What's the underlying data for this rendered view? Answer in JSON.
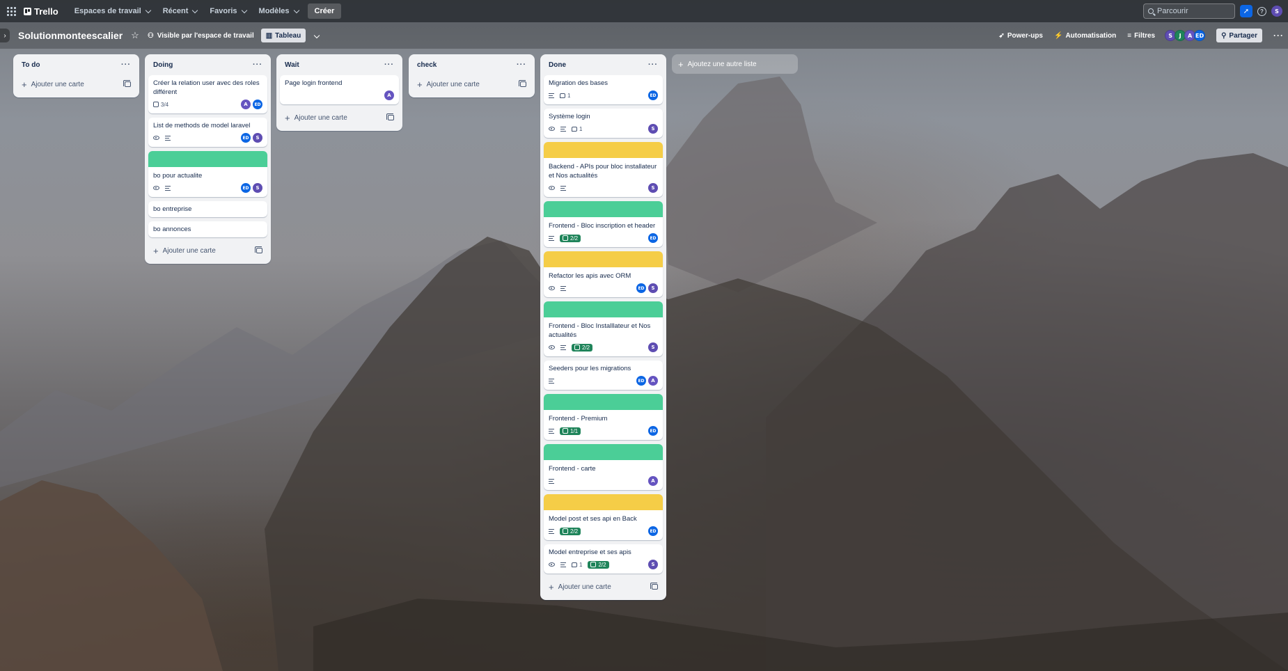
{
  "topnav": {
    "logo": "Trello",
    "menus": [
      {
        "label": "Espaces de travail"
      },
      {
        "label": "Récent"
      },
      {
        "label": "Favoris"
      },
      {
        "label": "Modèles"
      }
    ],
    "create_label": "Créer",
    "search_placeholder": "Parcourir",
    "user_initial": "S"
  },
  "board_header": {
    "title": "Solutionmonteescalier",
    "visibility": "Visible par l'espace de travail",
    "view": "Tableau",
    "powerups": "Power-ups",
    "automation": "Automatisation",
    "filters": "Filtres",
    "members": [
      "S",
      "J",
      "A",
      "ED"
    ],
    "share": "Partager"
  },
  "lists": [
    {
      "title": "To do",
      "add_label": "Ajouter une carte",
      "cards": []
    },
    {
      "title": "Doing",
      "add_label": "Ajouter une carte",
      "cards": [
        {
          "title": "Créer la relation user avec des roles différent",
          "checklist": "3/4",
          "members": [
            "A",
            "ED"
          ]
        },
        {
          "title": "List de methods de model laravel",
          "watch": true,
          "desc": true,
          "members": [
            "ED",
            "S"
          ]
        },
        {
          "title": "bo pour actualite",
          "cover": "green",
          "watch": true,
          "desc": true,
          "members": [
            "ED",
            "S"
          ]
        },
        {
          "title": "bo entreprise"
        },
        {
          "title": "bo annonces"
        }
      ]
    },
    {
      "title": "Wait",
      "add_label": "Ajouter une carte",
      "cards": [
        {
          "title": "Page login frontend",
          "members": [
            "A"
          ]
        }
      ]
    },
    {
      "title": "check",
      "add_label": "Ajouter une carte",
      "cards": []
    },
    {
      "title": "Done",
      "add_label": "Ajouter une carte",
      "cards": [
        {
          "title": "Migration des bases",
          "desc": true,
          "comments": "1",
          "members": [
            "ED"
          ]
        },
        {
          "title": "Système login",
          "watch": true,
          "desc": true,
          "comments": "1",
          "members": [
            "S"
          ]
        },
        {
          "title": "Backend - APIs pour bloc installateur et Nos actualités",
          "cover": "yellow",
          "watch": true,
          "desc": true,
          "members": [
            "S"
          ]
        },
        {
          "title": "Frontend - Bloc inscription et header",
          "cover": "green",
          "desc": true,
          "checklist": "2/2",
          "checklist_done": true,
          "members": [
            "ED"
          ]
        },
        {
          "title": "Refactor les apis avec ORM",
          "cover": "yellow",
          "watch": true,
          "desc": true,
          "members": [
            "ED",
            "S"
          ]
        },
        {
          "title": "Frontend - Bloc Installlateur et Nos actualités",
          "cover": "green",
          "watch": true,
          "desc": true,
          "checklist": "2/2",
          "checklist_done": true,
          "members": [
            "S"
          ]
        },
        {
          "title": "Seeders pour les migrations",
          "desc": true,
          "members": [
            "ED",
            "A"
          ]
        },
        {
          "title": "Frontend - Premium",
          "cover": "green",
          "desc": true,
          "checklist": "1/1",
          "checklist_done": true,
          "members": [
            "ED"
          ]
        },
        {
          "title": "Frontend - carte",
          "cover": "green",
          "desc": true,
          "members": [
            "A"
          ]
        },
        {
          "title": "Model post et ses api en Back",
          "cover": "yellow",
          "desc": true,
          "checklist": "2/2",
          "checklist_done": true,
          "members": [
            "ED"
          ]
        },
        {
          "title": "Model entreprise et ses apis",
          "watch": true,
          "desc": true,
          "comments": "1",
          "checklist": "2/2",
          "checklist_done": true,
          "members": [
            "S"
          ]
        }
      ]
    }
  ],
  "add_list_label": "Ajoutez une autre liste",
  "colors": {
    "cover_green": "#4bce97",
    "cover_yellow": "#f5cd47",
    "checklist_done": "#1f845a",
    "accent": "#0c66e4"
  }
}
